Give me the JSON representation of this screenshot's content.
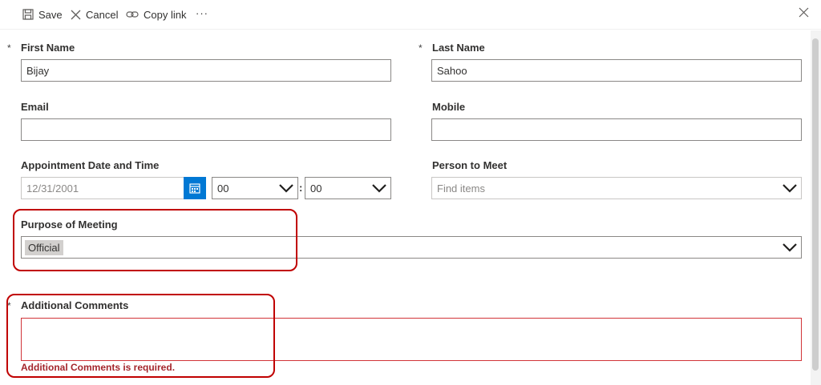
{
  "toolbar": {
    "save": "Save",
    "cancel": "Cancel",
    "copy_link": "Copy link",
    "more": "···"
  },
  "required_marker": "*",
  "form": {
    "first_name": {
      "label": "First Name",
      "value": "Bijay"
    },
    "last_name": {
      "label": "Last Name",
      "value": "Sahoo"
    },
    "email": {
      "label": "Email",
      "value": ""
    },
    "mobile": {
      "label": "Mobile",
      "value": ""
    },
    "appointment": {
      "label": "Appointment Date and Time",
      "date": "12/31/2001",
      "hour": "00",
      "minute": "00",
      "separator": ":"
    },
    "person_to_meet": {
      "label": "Person to Meet",
      "placeholder": "Find items"
    },
    "purpose": {
      "label": "Purpose of Meeting",
      "value": "Official"
    },
    "comments": {
      "label": "Additional Comments",
      "value": "",
      "error": "Additional Comments is required."
    }
  },
  "colors": {
    "accent": "#0078d4",
    "error": "#a4262c",
    "callout": "#c00000"
  }
}
